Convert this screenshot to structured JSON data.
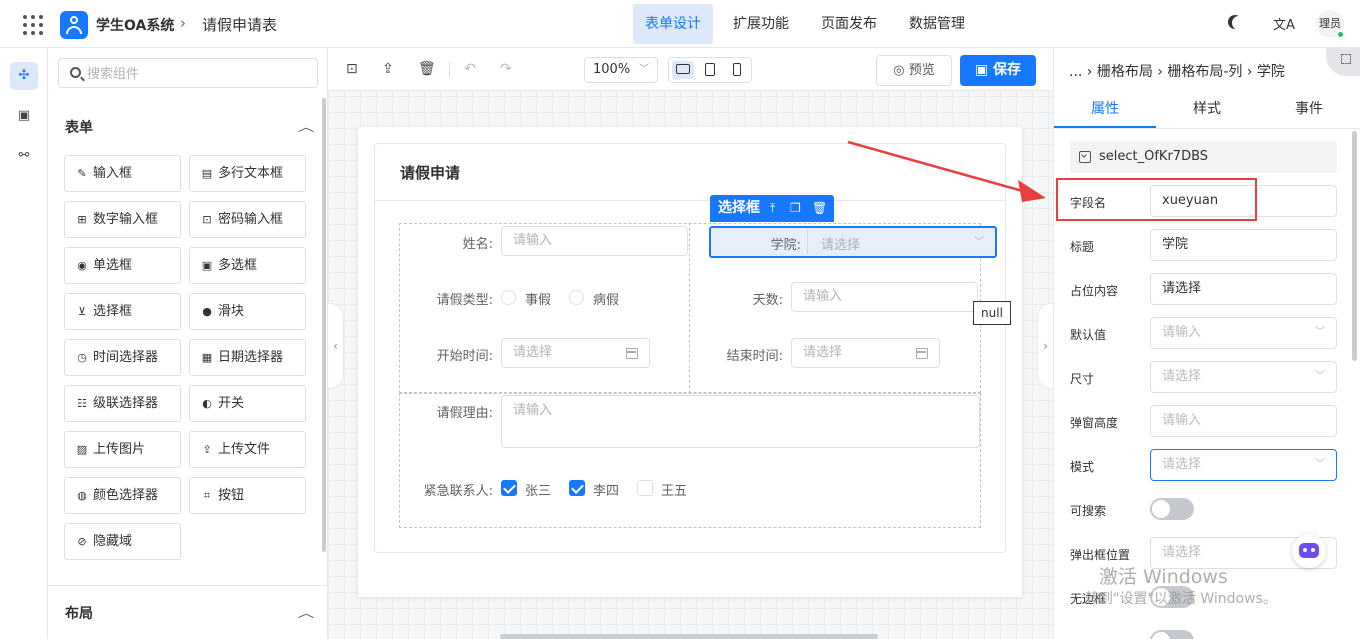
{
  "header": {
    "app_title": "学生OA系统",
    "breadcrumb_sep": "›",
    "page_name": "请假申请表",
    "nav": [
      {
        "label": "表单设计",
        "active": true
      },
      {
        "label": "扩展功能",
        "active": false
      },
      {
        "label": "页面发布",
        "active": false
      },
      {
        "label": "数据管理",
        "active": false
      }
    ],
    "translate_glyph": "文A",
    "user_name": "理员",
    "accent_color": "#1677ff"
  },
  "rail": {
    "items": [
      {
        "icon": "puzzle-icon",
        "glyph": "✣",
        "active": true
      },
      {
        "icon": "code-window-icon",
        "glyph": "▣",
        "active": false
      },
      {
        "icon": "tree-structure-icon",
        "glyph": "⚯",
        "active": false
      }
    ]
  },
  "components": {
    "search_placeholder": "搜索组件",
    "form_section": "表单",
    "layout_section": "布局",
    "items": [
      {
        "label": "输入框",
        "icon": "pencil-icon",
        "glyph": "✎"
      },
      {
        "label": "多行文本框",
        "icon": "textarea-icon",
        "glyph": "▤"
      },
      {
        "label": "数字输入框",
        "icon": "number-icon",
        "glyph": "⊞"
      },
      {
        "label": "密码输入框",
        "icon": "lock-icon",
        "glyph": "⊡"
      },
      {
        "label": "单选框",
        "icon": "radio-icon",
        "glyph": "◉"
      },
      {
        "label": "多选框",
        "icon": "checkbox-icon",
        "glyph": "▣"
      },
      {
        "label": "选择框",
        "icon": "select-icon",
        "glyph": "⊻"
      },
      {
        "label": "滑块",
        "icon": "slider-icon",
        "glyph": "●"
      },
      {
        "label": "时间选择器",
        "icon": "clock-icon",
        "glyph": "◷"
      },
      {
        "label": "日期选择器",
        "icon": "calendar-icon",
        "glyph": "▦"
      },
      {
        "label": "级联选择器",
        "icon": "cascader-icon",
        "glyph": "☷"
      },
      {
        "label": "开关",
        "icon": "switch-icon",
        "glyph": "◐"
      },
      {
        "label": "上传图片",
        "icon": "image-icon",
        "glyph": "▨"
      },
      {
        "label": "上传文件",
        "icon": "upload-icon",
        "glyph": "⇪"
      },
      {
        "label": "颜色选择器",
        "icon": "palette-icon",
        "glyph": "◍"
      },
      {
        "label": "按钮",
        "icon": "button-icon",
        "glyph": "⌗"
      },
      {
        "label": "隐藏域",
        "icon": "eye-off-icon",
        "glyph": "⊘"
      }
    ]
  },
  "toolbar": {
    "zoom": "100%",
    "preview_label": "预览",
    "save_label": "保存"
  },
  "form": {
    "title": "请假申请",
    "selected_tag": "选择框",
    "fields": {
      "name_label": "姓名:",
      "name_placeholder": "请输入",
      "college_label": "学院:",
      "college_placeholder": "请选择",
      "type_label": "请假类型:",
      "type_options": [
        "事假",
        "病假"
      ],
      "days_label": "天数:",
      "days_placeholder": "请输入",
      "start_label": "开始时间:",
      "start_placeholder": "请选择",
      "end_label": "结束时间:",
      "end_placeholder": "请选择",
      "reason_label": "请假理由:",
      "reason_placeholder": "请输入",
      "contact_label": "紧急联系人:",
      "contacts": [
        {
          "label": "张三",
          "checked": true
        },
        {
          "label": "李四",
          "checked": true
        },
        {
          "label": "王五",
          "checked": false
        }
      ]
    },
    "tooltip": "null"
  },
  "properties": {
    "breadcrumb": "... › 栅格布局 › 栅格布局-列 › 学院",
    "tabs": [
      "属性",
      "样式",
      "事件"
    ],
    "active_tab": "属性",
    "component_id": "select_OfKr7DBS",
    "rows": [
      {
        "label": "字段名",
        "value": "xueyuan",
        "placeholder": false
      },
      {
        "label": "标题",
        "value": "学院",
        "placeholder": false
      },
      {
        "label": "占位内容",
        "value": "请选择",
        "placeholder": false
      },
      {
        "label": "默认值",
        "value": "请输入",
        "placeholder": true
      },
      {
        "label": "尺寸",
        "value": "请选择",
        "placeholder": true
      },
      {
        "label": "弹窗高度",
        "value": "请输入",
        "placeholder": true
      },
      {
        "label": "模式",
        "value": "请选择",
        "placeholder": true
      },
      {
        "label": "可搜索",
        "toggle": true,
        "on": false
      },
      {
        "label": "弹出框位置",
        "value": "请选择",
        "placeholder": true
      },
      {
        "label": "无边框",
        "toggle": true,
        "on": false
      }
    ]
  },
  "watermark": {
    "line1": "激活 Windows",
    "line2": "转到\"设置\"以激活 Windows。"
  },
  "annotation": {
    "highlight_color": "#e8403e"
  }
}
